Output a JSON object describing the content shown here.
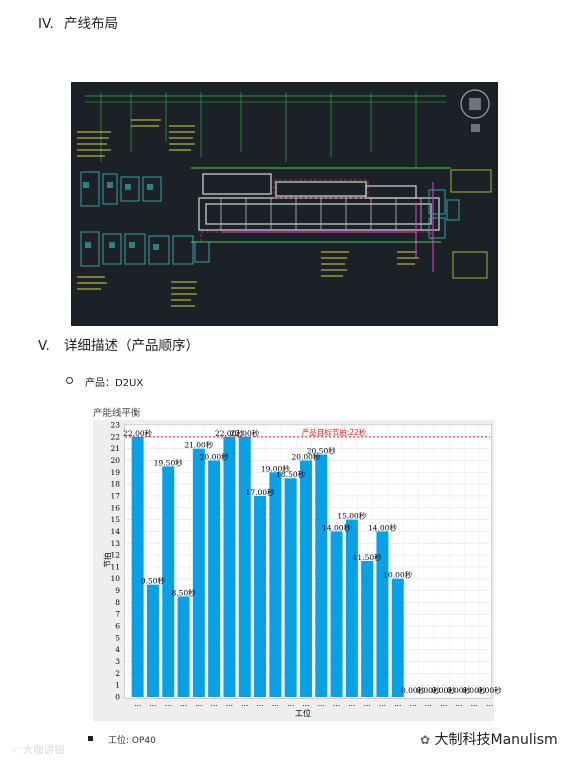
{
  "section4": {
    "num": "IV.",
    "title": "产线布局"
  },
  "section5": {
    "num": "V.",
    "title": "详细描述（产品顺序）"
  },
  "product": {
    "label": "产品：D2UX"
  },
  "chart_title": "产能线平衡",
  "chart_data": {
    "type": "bar",
    "title": "产能线平衡",
    "xlabel": "工位",
    "ylabel": "节拍",
    "ylim": [
      0,
      23
    ],
    "yticks": [
      0,
      1,
      2,
      3,
      4,
      5,
      6,
      7,
      8,
      9,
      10,
      11,
      12,
      13,
      14,
      15,
      16,
      17,
      18,
      19,
      20,
      21,
      22,
      23
    ],
    "target": {
      "value": 22,
      "label": "产品目标节拍:22秒"
    },
    "categories": [
      "...",
      "...",
      "...",
      "...",
      "...",
      "...",
      "...",
      "...",
      "...",
      "...",
      "...",
      "...",
      "...",
      "...",
      "...",
      "...",
      "...",
      "...",
      "...",
      "...",
      "...",
      "...",
      "...",
      "..."
    ],
    "values": [
      22.0,
      9.5,
      19.5,
      8.5,
      21.0,
      20.0,
      22.0,
      22.0,
      17.0,
      19.0,
      18.5,
      20.0,
      20.5,
      14.0,
      15.0,
      11.5,
      14.0,
      10.0,
      0,
      0,
      0,
      0,
      0,
      0
    ],
    "value_labels": [
      "22.00秒",
      "9.50秒",
      "19.50秒",
      "8.50秒",
      "21.00秒",
      "20.00秒",
      "22.00秒",
      "22.00秒",
      "17.00秒",
      "19.00秒",
      "18.50秒",
      "20.00秒",
      "20.50秒",
      "14.00秒",
      "15.00秒",
      "11.50秒",
      "14.00秒",
      "10.00秒",
      "0.00秒",
      "0.00秒",
      "0.00秒",
      "0.00秒",
      "0.00秒",
      "0.00秒"
    ],
    "bar_color": "#0aa0e6",
    "target_color": "#e01b1b",
    "grid": true
  },
  "station": {
    "label": "工位: OP40"
  },
  "watermarks": {
    "left": "大咖讲银",
    "right": "大制科技Manulism"
  }
}
